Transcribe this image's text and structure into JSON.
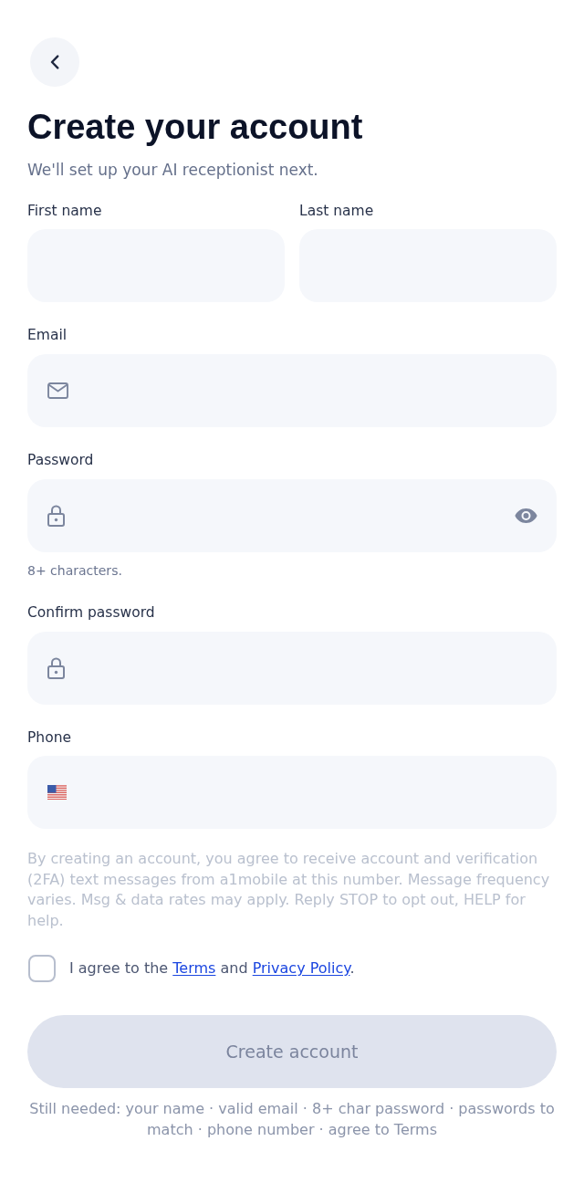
{
  "header": {
    "title": "Create your account",
    "subtitle": "We'll set up your AI receptionist next."
  },
  "name_fields": [
    {
      "label": "First name",
      "kind": "text"
    },
    {
      "label": "Last name",
      "kind": "text"
    }
  ],
  "fields": [
    {
      "label": "Email",
      "kind": "email"
    },
    {
      "label": "Password",
      "kind": "password",
      "hint": "8+ characters."
    },
    {
      "label": "Confirm password",
      "kind": "confirm_password"
    },
    {
      "label": "Phone",
      "kind": "phone"
    }
  ],
  "consent_notice": "By creating an account, you agree to receive account and verification (2FA) text messages from a1mobile at this number. Message frequency varies. Msg & data rates may apply. Reply STOP to opt out, HELP for help.",
  "agreement": {
    "checked": false,
    "parts": [
      {
        "kind": "text",
        "text": "I agree to the "
      },
      {
        "kind": "link",
        "text": "Terms"
      },
      {
        "kind": "text",
        "text": " and "
      },
      {
        "kind": "link",
        "text": "Privacy Policy"
      },
      {
        "kind": "text",
        "text": "."
      }
    ]
  },
  "submit_button": {
    "label": "Create account",
    "disabled": true
  },
  "requirements_note": "Still needed: your name · valid email · 8+ char password · passwords to match · phone number · agree to Terms"
}
